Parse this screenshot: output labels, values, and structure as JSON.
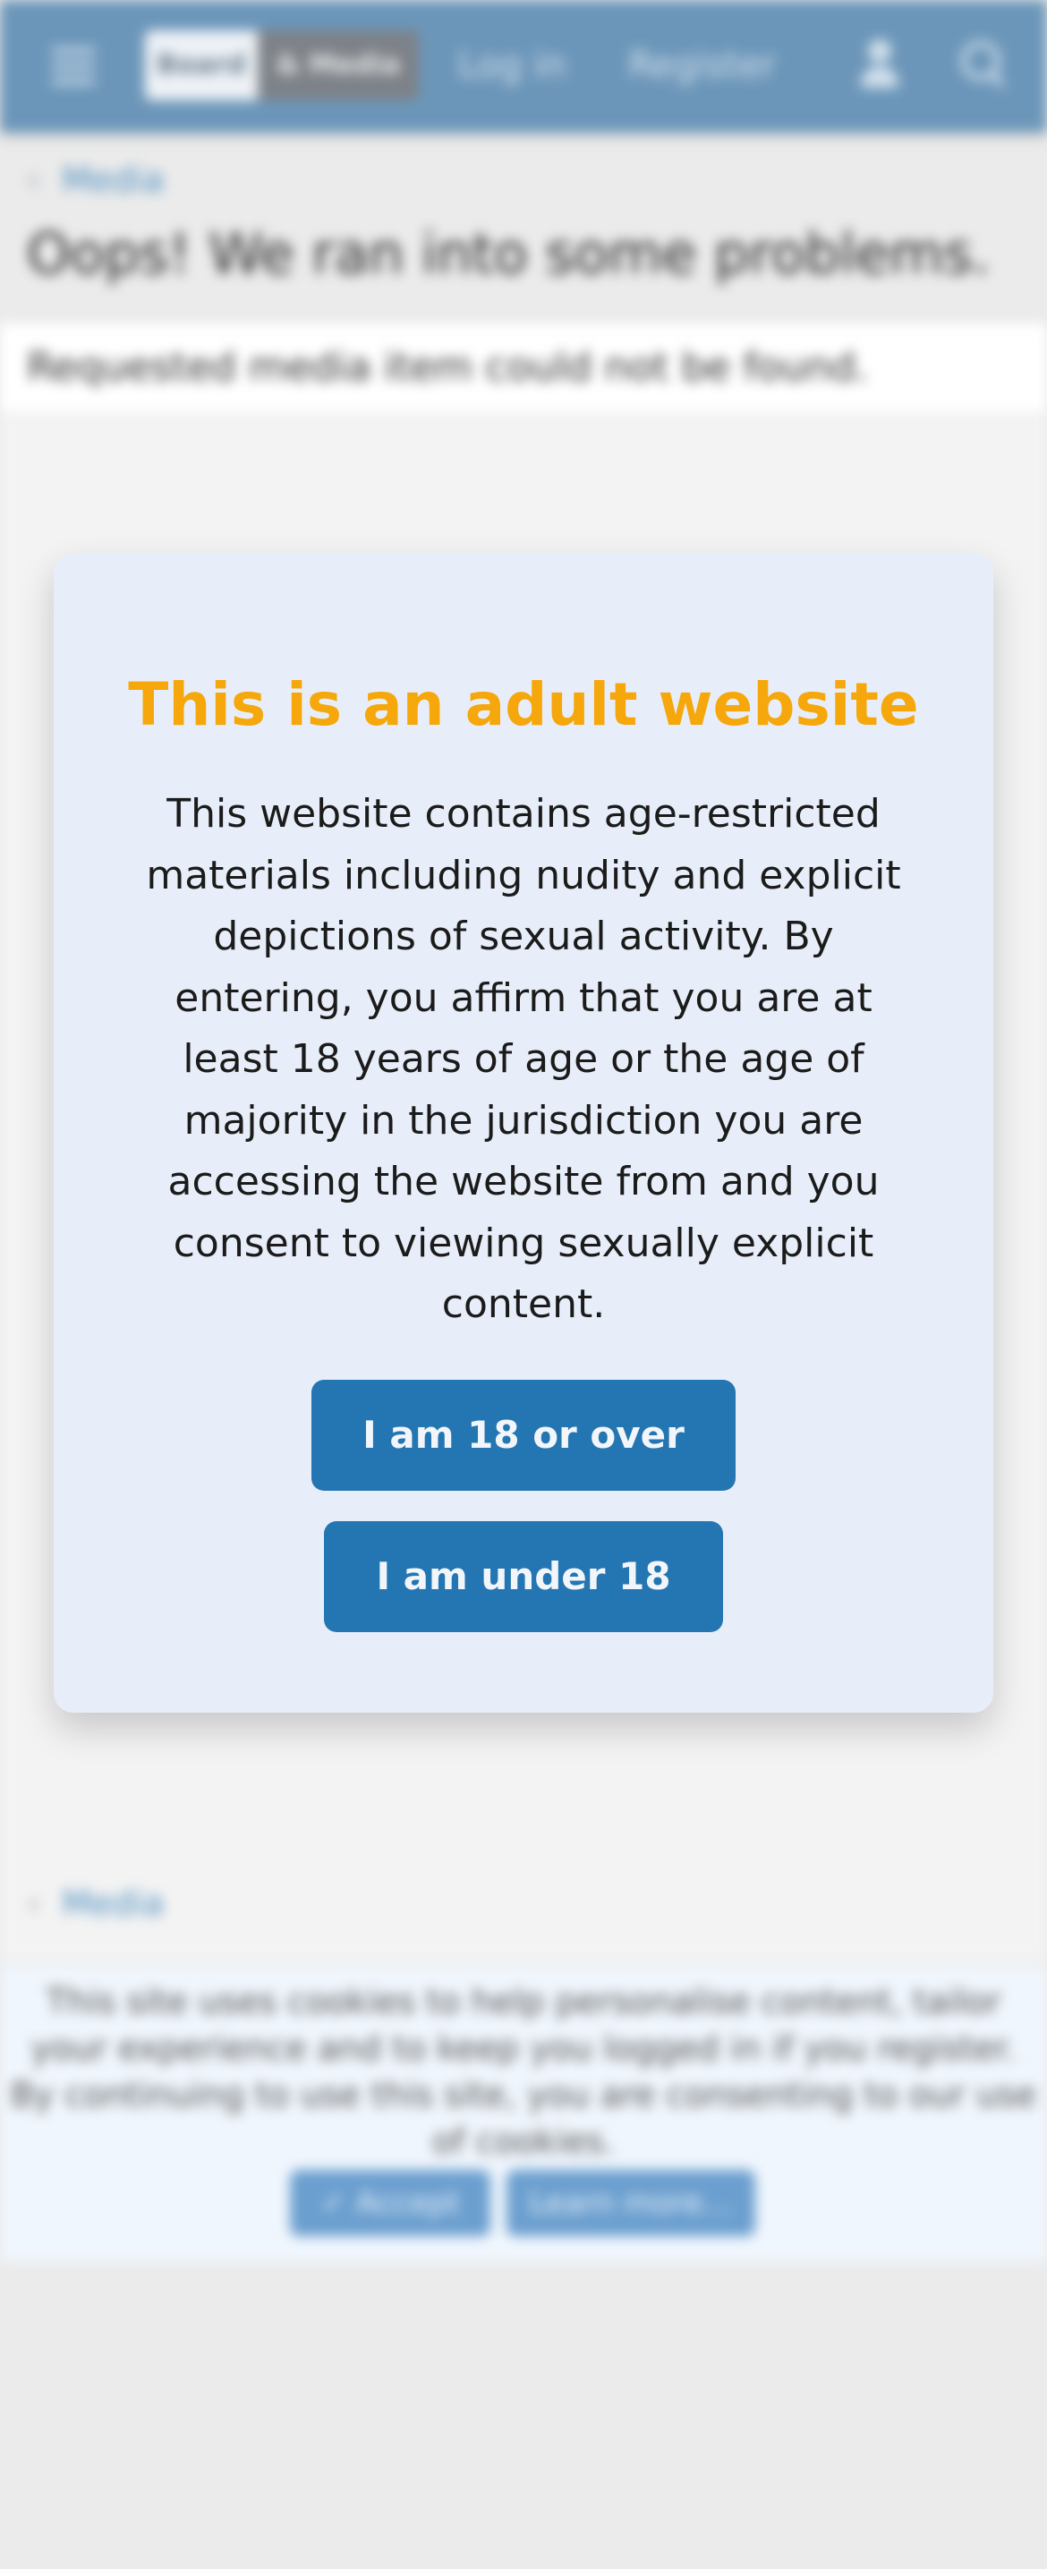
{
  "header": {
    "logo_part1": "Board",
    "logo_part2": "& Media",
    "login_label": "Log in",
    "register_label": "Register"
  },
  "breadcrumb_top": "Media",
  "error": {
    "title": "Oops! We ran into some problems.",
    "message": "Requested media item could not be found."
  },
  "breadcrumb_bottom": "Media",
  "cookie_notice": {
    "text": "This site uses cookies to help personalise content, tailor your experience and to keep you logged in if you register. By continuing to use this site, you are consenting to our use of cookies.",
    "accept_label": "✓ Accept",
    "learn_more_label": "Learn more…"
  },
  "age_modal": {
    "title": "This is an adult website",
    "body": "This website contains age-restricted materials including nudity and explicit depictions of sexual activity. By entering, you affirm that you are at least 18 years of age or the age of majority in the jurisdiction you are accessing the website from and you consent to viewing sexually explicit content.",
    "over_button": "I am 18 or over",
    "under_button": "I am under 18"
  },
  "colors": {
    "header_bg": "#6c96b9",
    "modal_bg": "#e8eef9",
    "title_accent": "#f5a70b",
    "button_bg": "#2476b2"
  }
}
